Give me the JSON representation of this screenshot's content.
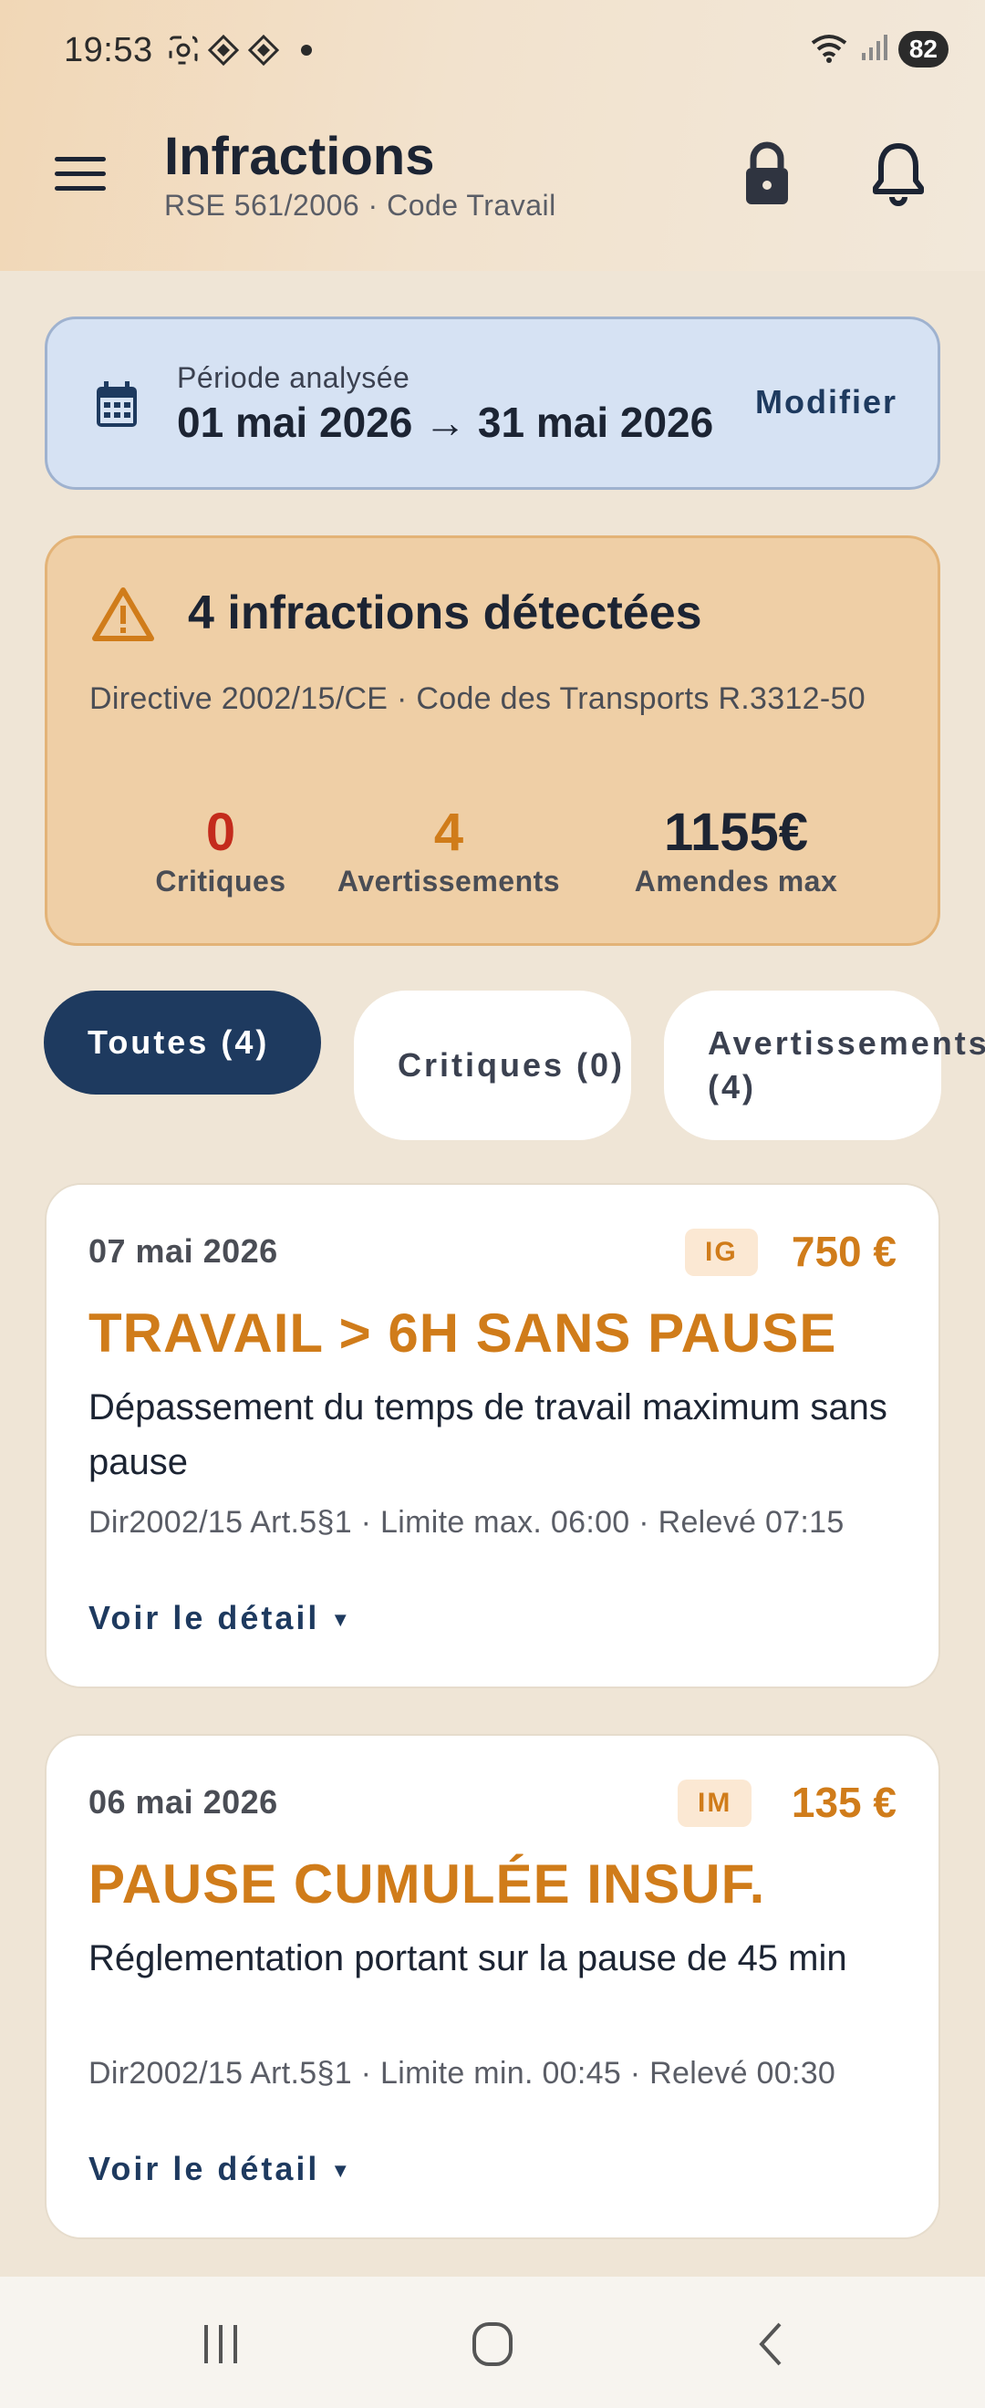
{
  "status_bar": {
    "time": "19:53",
    "battery": "82",
    "icons_left": [
      "screenshot-icon",
      "app-notification-icon",
      "app-notification-icon"
    ],
    "icons_right": [
      "wifi-icon",
      "signal-icon"
    ]
  },
  "header": {
    "title": "Infractions",
    "subtitle": "RSE 561/2006 · Code Travail",
    "icons": [
      "menu-icon",
      "lock-icon",
      "bell-icon"
    ]
  },
  "period": {
    "label": "Période analysée",
    "value": "01 mai 2026 → 31 mai 2026",
    "action": "Modifier"
  },
  "summary": {
    "title": "4 infractions détectées",
    "subtitle": "Directive 2002/15/CE  ·  Code des Transports R.3312-50",
    "stats": [
      {
        "value": "0",
        "label": "Critiques"
      },
      {
        "value": "4",
        "label": "Avertissements"
      },
      {
        "value": "1155€",
        "label": "Amendes max"
      }
    ]
  },
  "filters": [
    {
      "label": "Toutes (4)",
      "selected": true
    },
    {
      "label": "Critiques (0)",
      "selected": false
    },
    {
      "label": "Avertissements (4)",
      "selected": false
    }
  ],
  "infractions": [
    {
      "date": "07 mai 2026",
      "badge": "IG",
      "amount": "750 €",
      "title": "TRAVAIL > 6H SANS PAUSE",
      "description": "Dépassement du temps de travail maximum sans pause",
      "meta": "Dir2002/15 Art.5§1 · Limite max. 06:00 · Relevé 07:15",
      "detail": "Voir le détail"
    },
    {
      "date": "06 mai 2026",
      "badge": "IM",
      "amount": "135 €",
      "title": "PAUSE CUMULÉE INSUF.",
      "description": "Réglementation portant sur la pause de 45 min",
      "meta": "Dir2002/15 Art.5§1 · Limite min. 00:45 · Relevé 00:30",
      "detail": "Voir le détail"
    }
  ],
  "colors": {
    "primary": "#1e3a5f",
    "warning": "#d07c1a",
    "critical": "#c42b1c",
    "period_bg": "#d6e2f3",
    "summary_bg": "#efcfa6"
  }
}
